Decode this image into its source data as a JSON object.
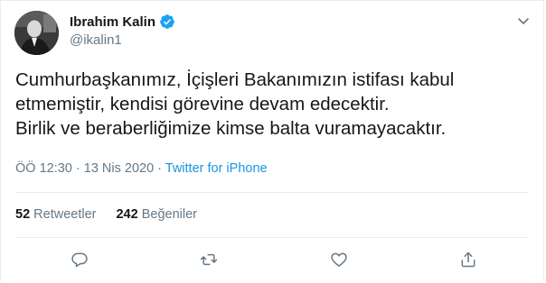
{
  "user": {
    "display_name": "Ibrahim Kalin",
    "handle": "@ikalin1",
    "verified": true
  },
  "tweet": {
    "lines": [
      "Cumhurbaşkanımız, İçişleri Bakanımızın istifası kabul",
      "etmemiştir, kendisi görevine devam edecektir.",
      "Birlik ve beraberliğimize kimse balta vuramayacaktır."
    ],
    "time": "ÖÖ 12:30",
    "separator": " · ",
    "date": "13 Nis 2020",
    "source": "Twitter for iPhone"
  },
  "stats": {
    "retweets_count": "52",
    "retweets_label": "Retweetler",
    "likes_count": "242",
    "likes_label": "Beğeniler"
  },
  "icons": {
    "verified": "verified-badge-icon",
    "caret": "chevron-down-icon",
    "reply": "reply-icon",
    "retweet": "retweet-icon",
    "like": "heart-icon",
    "share": "share-icon"
  },
  "colors": {
    "accent": "#1da1f2",
    "link": "#1b95e0",
    "muted": "#657786",
    "text": "#14171a",
    "border": "#e6ecf0"
  }
}
